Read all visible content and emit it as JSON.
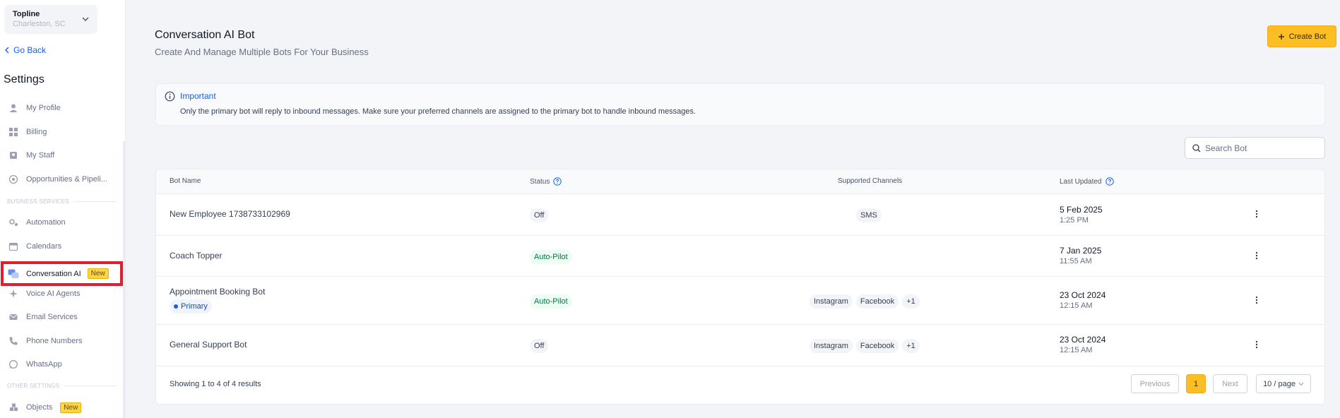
{
  "sidebar": {
    "location": {
      "name": "Topline",
      "subtitle": "Charleston, SC"
    },
    "go_back": "Go Back",
    "title": "Settings",
    "items_top": [
      "My Profile",
      "Billing",
      "My Staff",
      "Opportunities & Pipeli..."
    ],
    "section_business": "BUSINESS SERVICES",
    "items_business": [
      "Automation",
      "Calendars"
    ],
    "active_item": {
      "label": "Conversation AI",
      "badge": "New"
    },
    "items_business_2": [
      "Voice AI Agents",
      "Email Services",
      "Phone Numbers",
      "WhatsApp"
    ],
    "section_other": "OTHER SETTINGS",
    "objects": {
      "label": "Objects",
      "badge": "New"
    }
  },
  "header": {
    "title": "Conversation AI Bot",
    "subtitle": "Create And Manage Multiple Bots For Your Business",
    "create_button": "Create Bot"
  },
  "notice": {
    "title": "Important",
    "body": "Only the primary bot will reply to inbound messages. Make sure your preferred channels are assigned to the primary bot to handle inbound messages."
  },
  "search": {
    "placeholder": "Search Bot"
  },
  "table": {
    "columns": [
      "Bot Name",
      "Status",
      "Supported Channels",
      "Last Updated"
    ],
    "rows": [
      {
        "name": "New Employee 1738733102969",
        "status": "Off",
        "channels": [
          "SMS"
        ],
        "date": "5 Feb 2025",
        "time": "1:25 PM"
      },
      {
        "name": "Coach Topper",
        "status": "Auto-Pilot",
        "channels": [],
        "date": "7 Jan 2025",
        "time": "11:55 AM"
      },
      {
        "name": "Appointment Booking Bot",
        "tag": "Primary",
        "status": "Auto-Pilot",
        "channels": [
          "Instagram",
          "Facebook",
          "+1"
        ],
        "date": "23 Oct 2024",
        "time": "12:15 AM"
      },
      {
        "name": "General Support Bot",
        "status": "Off",
        "channels": [
          "Instagram",
          "Facebook",
          "+1"
        ],
        "date": "23 Oct 2024",
        "time": "12:15 AM"
      }
    ]
  },
  "pagination": {
    "summary": "Showing 1 to 4 of 4 results",
    "previous": "Previous",
    "page": "1",
    "next": "Next",
    "page_size": "10 / page"
  },
  "colors": {
    "accent": "#fbbf24",
    "link": "#155eef",
    "highlight_border": "#e11d2e"
  }
}
